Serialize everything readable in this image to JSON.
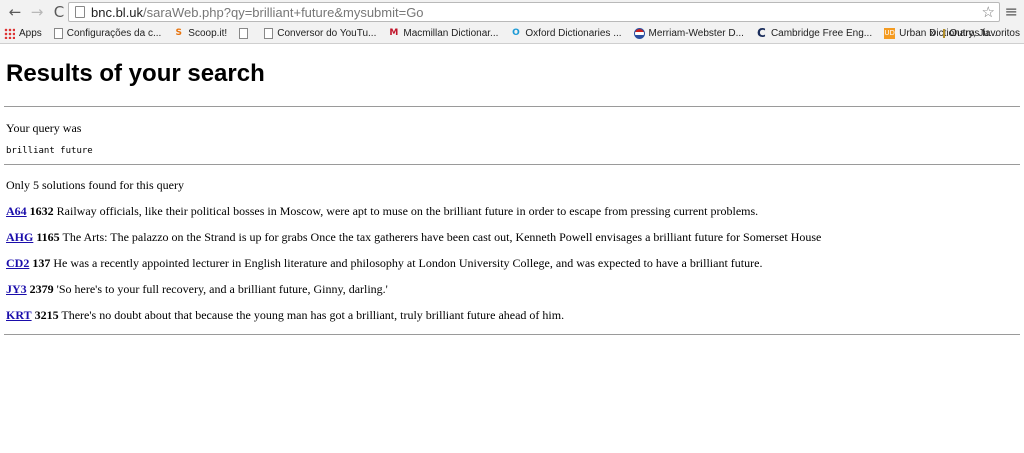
{
  "browser": {
    "url_host": "bnc.bl.uk",
    "url_path": "/saraWeb.php?qy=brilliant+future&mysubmit=Go",
    "back_icon": "←",
    "forward_icon": "→",
    "reload_icon": "C",
    "star_icon": "☆",
    "menu_icon": "≡"
  },
  "bookmarks": {
    "items": [
      {
        "label": "Apps",
        "icon": "apps-icon"
      },
      {
        "label": "Configurações da c...",
        "icon": "doc-icon"
      },
      {
        "label": "Scoop.it!",
        "icon": "scoop-icon"
      },
      {
        "label": "",
        "icon": "doc-icon"
      },
      {
        "label": "Conversor do YouTu...",
        "icon": "doc-icon"
      },
      {
        "label": "Macmillan Dictionar...",
        "icon": "macmillan-icon"
      },
      {
        "label": "Oxford Dictionaries ...",
        "icon": "oxford-icon"
      },
      {
        "label": "Merriam-Webster D...",
        "icon": "merriam-webster-icon"
      },
      {
        "label": "Cambridge Free Eng...",
        "icon": "cambridge-icon"
      },
      {
        "label": "Urban Dictionary, Ju...",
        "icon": "urban-dictionary-icon"
      }
    ],
    "more": "»",
    "other": "Outros favoritos"
  },
  "page": {
    "title": "Results of your search",
    "query_label": "Your query was",
    "query_value": "brilliant future",
    "count_text": "Only 5 solutions found for this query",
    "results": [
      {
        "code": "A64",
        "num": "1632",
        "text": "Railway officials, like their political bosses in Moscow, were apt to muse on the brilliant future in order to escape from pressing current problems."
      },
      {
        "code": "AHG",
        "num": "1165",
        "text": "The Arts: The palazzo on the Strand is up for grabs Once the tax gatherers have been cast out, Kenneth Powell envisages a brilliant future for Somerset House"
      },
      {
        "code": "CD2",
        "num": "137",
        "text": "He was a recently appointed lecturer in English literature and philosophy at London University College, and was expected to have a brilliant future."
      },
      {
        "code": "JY3",
        "num": "2379",
        "text": "'So here's to your full recovery, and a brilliant future, Ginny, darling.'"
      },
      {
        "code": "KRT",
        "num": "3215",
        "text": "There's no doubt about that because the young man has got a brilliant, truly brilliant future ahead of him."
      }
    ]
  }
}
